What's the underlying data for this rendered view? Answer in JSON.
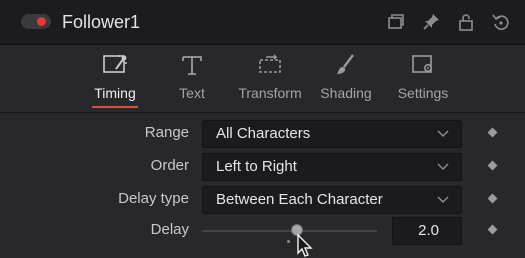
{
  "header": {
    "title": "Follower1",
    "toggle_color": "#e33a34",
    "icons": [
      "window-icon",
      "pin-icon",
      "lock-icon",
      "reset-icon"
    ]
  },
  "tabs": [
    {
      "label": "Timing",
      "icon": "timing-icon",
      "active": true
    },
    {
      "label": "Text",
      "icon": "text-icon",
      "active": false
    },
    {
      "label": "Transform",
      "icon": "transform-icon",
      "active": false
    },
    {
      "label": "Shading",
      "icon": "brush-icon",
      "active": false
    },
    {
      "label": "Settings",
      "icon": "settings-icon",
      "active": false
    }
  ],
  "accent_color": "#d4513f",
  "controls": {
    "range": {
      "label": "Range",
      "value": "All Characters"
    },
    "order": {
      "label": "Order",
      "value": "Left to Right"
    },
    "delay_type": {
      "label": "Delay type",
      "value": "Between Each Character"
    },
    "delay": {
      "label": "Delay",
      "value": "2.0"
    }
  }
}
